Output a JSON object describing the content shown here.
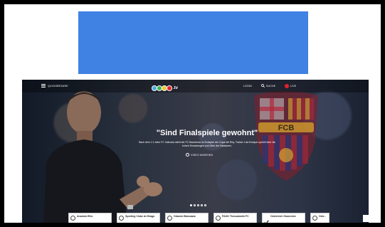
{
  "site": {
    "nav": {
      "menu_label": "QUICKBROWSE",
      "login": "LOGIN",
      "search": "SUCHE",
      "live": "LIVE"
    },
    "logo_text": ".tv",
    "hero": {
      "headline": "\"Sind Finalspiele gewohnt\"",
      "subtitle_line1": "Nach dem 1:1 beim FC Valencia steht der FC Barcelona im Endspiel der Copa del Rey. Trainer Luis Enrique spricht über die",
      "subtitle_line2": "hohen Erwartungen und Ziele der Katalanen.",
      "video_link": "VIDEO ANSEHEN"
    },
    "cards": [
      {
        "title": "Anadolu Efes",
        "meta": ""
      },
      {
        "title": "Sporting Clube de Braga",
        "meta": ""
      },
      {
        "title": "Gdansk Warszawa",
        "meta": ""
      },
      {
        "title": "PAOK Thessaloniki FC",
        "meta": ""
      },
      {
        "title": "Österreich Slowenien",
        "meta": ""
      },
      {
        "title": "Ostr...",
        "meta": ""
      }
    ]
  },
  "colors": {
    "banner": "#3f82e3",
    "live": "#e4202e"
  }
}
